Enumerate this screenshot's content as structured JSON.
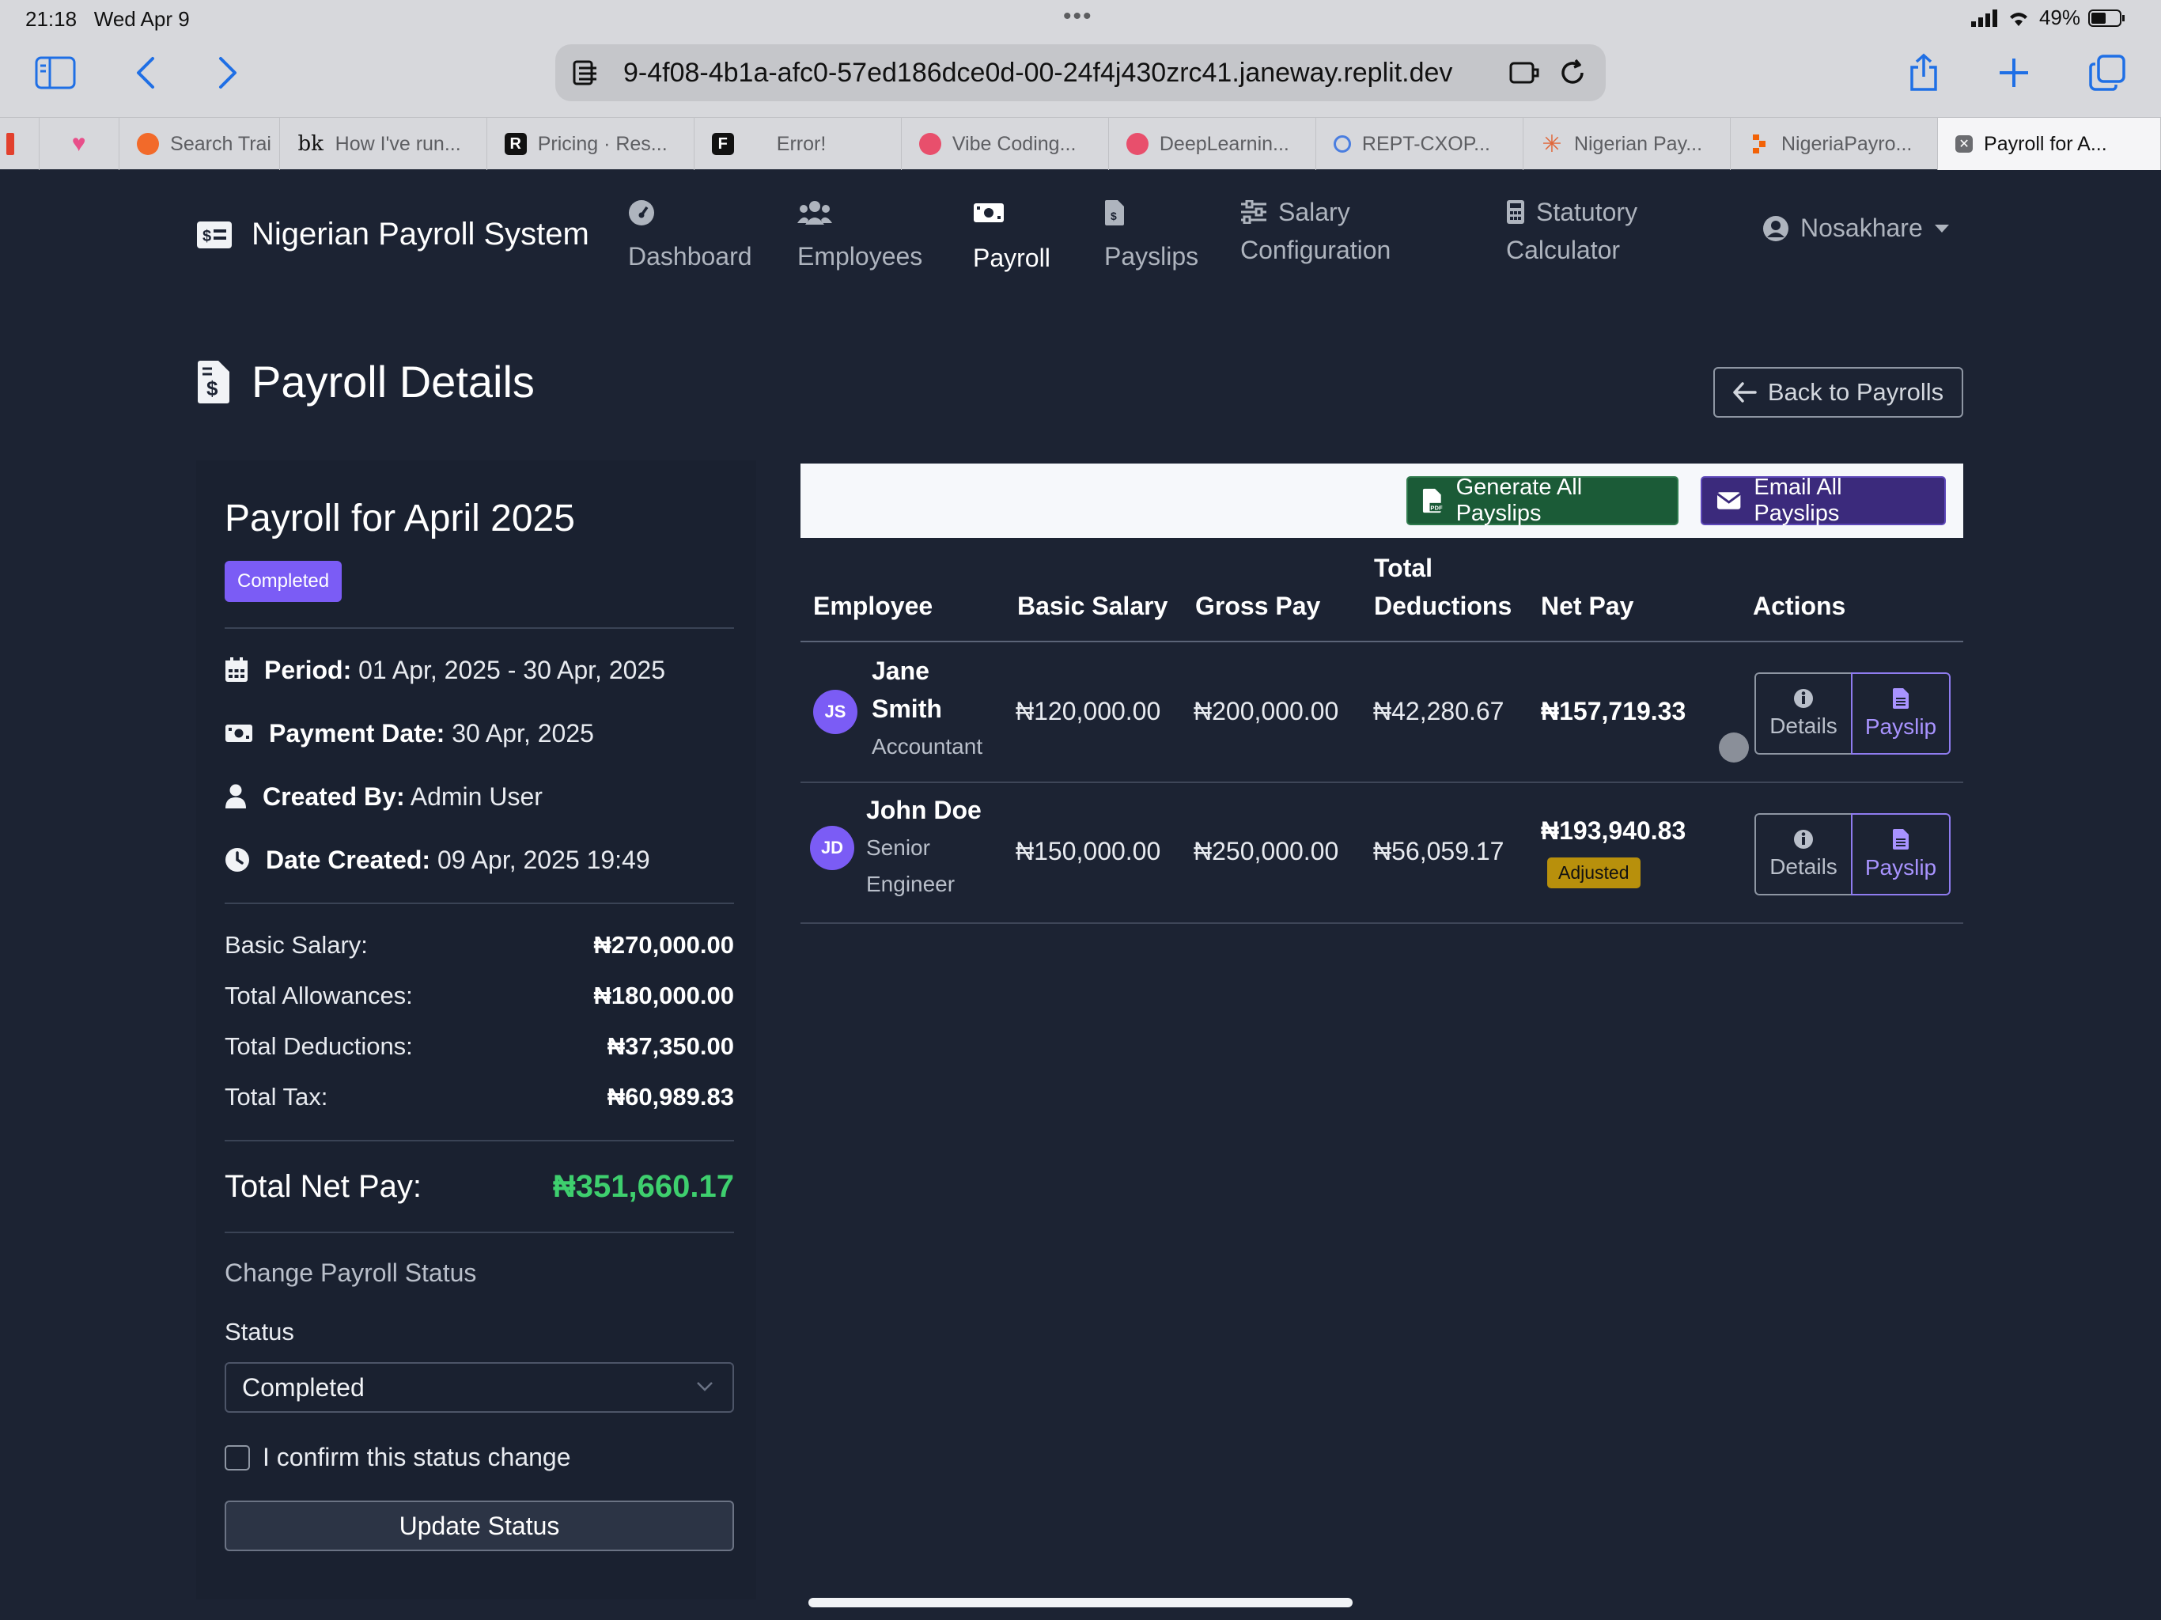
{
  "status_bar": {
    "time": "21:18",
    "date": "Wed Apr 9",
    "battery": "49%"
  },
  "browser": {
    "url": "9-4f08-4b1a-afc0-57ed186dce0d-00-24f4j430zrc41.janeway.replit.dev",
    "tabs": [
      {
        "label": "",
        "icon": "red-bar-icon",
        "color": "#e2402d"
      },
      {
        "label": "",
        "icon": "heart-icon",
        "color": "#e84f8a"
      },
      {
        "label": "Search Trai",
        "icon": "orange-circle-icon",
        "color": "#f26a2a"
      },
      {
        "label": "How I've run...",
        "icon": "bk-text-icon",
        "color": "#111111"
      },
      {
        "label": "Pricing · Res...",
        "icon": "r-logo-icon",
        "color": "#111111"
      },
      {
        "label": "Error!",
        "icon": "f-logo-icon",
        "color": "#111111"
      },
      {
        "label": "Vibe Coding...",
        "icon": "pink-circle-icon",
        "color": "#e84f6c"
      },
      {
        "label": "DeepLearnin...",
        "icon": "pink-circle-icon",
        "color": "#e84f6c"
      },
      {
        "label": "REPT-CXOP...",
        "icon": "ring-icon",
        "color": "#4a7ee0"
      },
      {
        "label": "Nigerian Pay...",
        "icon": "sunburst-icon",
        "color": "#e0673a"
      },
      {
        "label": "NigeriaPayro...",
        "icon": "replit-icon",
        "color": "#f26207"
      },
      {
        "label": "Payroll for A...",
        "icon": "close-tab-icon",
        "color": "#6b6c70"
      }
    ]
  },
  "nav": {
    "brand": "Nigerian Payroll System",
    "items": [
      {
        "label": "Dashboard",
        "icon": "gauge-icon"
      },
      {
        "label": "Employees",
        "icon": "users-icon"
      },
      {
        "label": "Payroll",
        "icon": "money-bill-icon"
      },
      {
        "label": "Payslips",
        "icon": "file-invoice-icon"
      },
      {
        "label": "Salary",
        "label2": "Configuration",
        "icon": "sliders-icon"
      },
      {
        "label": "Statutory",
        "label2": "Calculator",
        "icon": "calculator-icon"
      }
    ],
    "active": "Payroll",
    "user": "Nosakhare"
  },
  "page": {
    "title": "Payroll Details",
    "back_button": "Back to Payrolls"
  },
  "summary": {
    "heading": "Payroll for April 2025",
    "status_badge": "Completed",
    "period_label": "Period:",
    "period_value": "01 Apr, 2025 - 30 Apr, 2025",
    "payment_label": "Payment Date:",
    "payment_value": "30 Apr, 2025",
    "created_by_label": "Created By:",
    "created_by_value": "Admin User",
    "date_created_label": "Date Created:",
    "date_created_value": "09 Apr, 2025 19:49",
    "totals": [
      {
        "label": "Basic Salary:",
        "value": "₦270,000.00"
      },
      {
        "label": "Total Allowances:",
        "value": "₦180,000.00"
      },
      {
        "label": "Total Deductions:",
        "value": "₦37,350.00"
      },
      {
        "label": "Total Tax:",
        "value": "₦60,989.83"
      }
    ],
    "net_label": "Total Net Pay:",
    "net_value": "₦351,660.17",
    "change_title": "Change Payroll Status",
    "status_label": "Status",
    "status_selected": "Completed",
    "confirm_label": "I confirm this status change",
    "update_button": "Update Status"
  },
  "actions": {
    "generate": "Generate All Payslips",
    "email": "Email All Payslips"
  },
  "table": {
    "headers": {
      "employee": "Employee",
      "basic": "Basic Salary",
      "gross": "Gross Pay",
      "deductions_1": "Total",
      "deductions_2": "Deductions",
      "net": "Net Pay",
      "actions": "Actions"
    },
    "rows": [
      {
        "initials": "JS",
        "name_1": "Jane",
        "name_2": "Smith",
        "role_1": "Accountant",
        "role_2": "",
        "basic": "₦120,000.00",
        "gross": "₦200,000.00",
        "deductions": "₦42,280.67",
        "net": "₦157,719.33",
        "badge": "",
        "details": "Details",
        "payslip": "Payslip"
      },
      {
        "initials": "JD",
        "name_1": "John Doe",
        "name_2": "",
        "role_1": "Senior",
        "role_2": "Engineer",
        "basic": "₦150,000.00",
        "gross": "₦250,000.00",
        "deductions": "₦56,059.17",
        "net": "₦193,940.83",
        "badge": "Adjusted",
        "details": "Details",
        "payslip": "Payslip"
      }
    ]
  },
  "colors": {
    "accent": "#7b5cf5",
    "net_pay": "#3ecf6e",
    "background": "#1c2333",
    "generate": "#1b5b37",
    "email": "#3b2a7c",
    "adjusted": "#b8900c"
  }
}
